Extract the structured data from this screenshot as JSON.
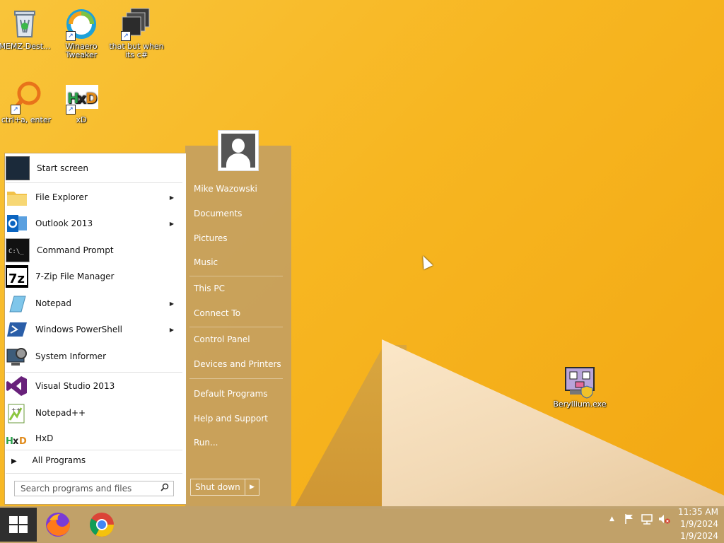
{
  "desktop": {
    "icons": [
      {
        "label": "MEMZ-Dest..."
      },
      {
        "label": "Winaero Tweaker"
      },
      {
        "label": "that but when its c#"
      },
      {
        "label": "ctrl+a, enter"
      },
      {
        "label": "xD"
      },
      {
        "label": "Beryllium.exe"
      }
    ]
  },
  "start_menu": {
    "programs": [
      {
        "label": "Start screen"
      },
      {
        "label": "File Explorer"
      },
      {
        "label": "Outlook 2013"
      },
      {
        "label": "Command Prompt"
      },
      {
        "label": "7-Zip File Manager"
      },
      {
        "label": "Notepad"
      },
      {
        "label": "Windows PowerShell"
      },
      {
        "label": "System Informer"
      },
      {
        "label": "Visual Studio 2013"
      },
      {
        "label": "Notepad++"
      },
      {
        "label": "HxD"
      }
    ],
    "all_programs": "All Programs",
    "search_placeholder": "Search programs and files",
    "right": {
      "user": "Mike Wazowski",
      "documents": "Documents",
      "pictures": "Pictures",
      "music": "Music",
      "this_pc": "This PC",
      "connect_to": "Connect To",
      "control_panel": "Control Panel",
      "devices": "Devices and Printers",
      "default_programs": "Default Programs",
      "help": "Help and Support",
      "run": "Run..."
    },
    "shutdown": "Shut down"
  },
  "taskbar": {
    "time": "11:35 AM",
    "date": "1/9/2024"
  }
}
